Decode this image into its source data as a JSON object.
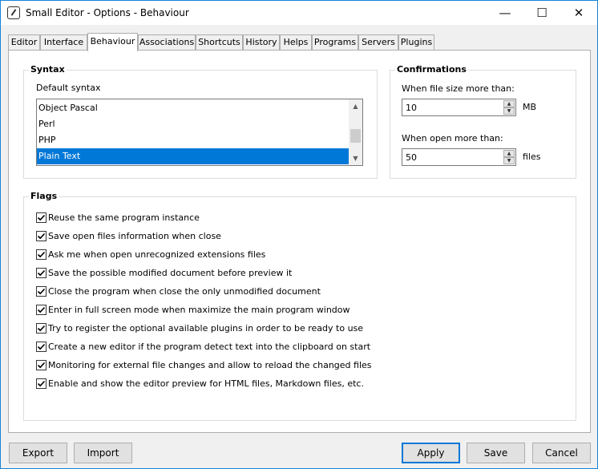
{
  "window": {
    "title": "Small Editor - Options - Behaviour",
    "app_icon": "small-editor-icon",
    "controls": {
      "minimize": "—",
      "maximize": "☐",
      "close": "✕"
    }
  },
  "tabs": [
    "Editor",
    "Interface",
    "Behaviour",
    "Associations",
    "Shortcuts",
    "History",
    "Helps",
    "Programs",
    "Servers",
    "Plugins"
  ],
  "active_tab": "Behaviour",
  "syntax": {
    "group_title": "Syntax",
    "label": "Default syntax",
    "items": [
      "Object Pascal",
      "Perl",
      "PHP",
      "Plain Text"
    ],
    "selected": "Plain Text"
  },
  "confirmations": {
    "group_title": "Confirmations",
    "file_size_label": "When file size more than:",
    "file_size_value": "10",
    "file_size_unit": "MB",
    "open_label": "When open more than:",
    "open_value": "50",
    "open_unit": "files"
  },
  "flags": {
    "group_title": "Flags",
    "items": [
      {
        "label": "Reuse the same program instance",
        "checked": true
      },
      {
        "label": "Save open files information when close",
        "checked": true
      },
      {
        "label": "Ask me when open unrecognized extensions files",
        "checked": true
      },
      {
        "label": "Save the possible modified document before preview it",
        "checked": true
      },
      {
        "label": "Close the program when close the only unmodified document",
        "checked": true
      },
      {
        "label": "Enter in full screen mode when maximize the main program window",
        "checked": true
      },
      {
        "label": "Try to register the optional available plugins in order to be ready to use",
        "checked": true
      },
      {
        "label": "Create a new editor if the program detect text into the clipboard on start",
        "checked": true
      },
      {
        "label": "Monitoring for external file changes and allow to reload the changed files",
        "checked": true
      },
      {
        "label": "Enable and show the editor preview for HTML files, Markdown files, etc.",
        "checked": true
      }
    ]
  },
  "buttons": {
    "export": "Export",
    "import": "Import",
    "apply": "Apply",
    "save": "Save",
    "cancel": "Cancel"
  },
  "colors": {
    "accent": "#0078d7",
    "selection_text": "#ffffff"
  }
}
